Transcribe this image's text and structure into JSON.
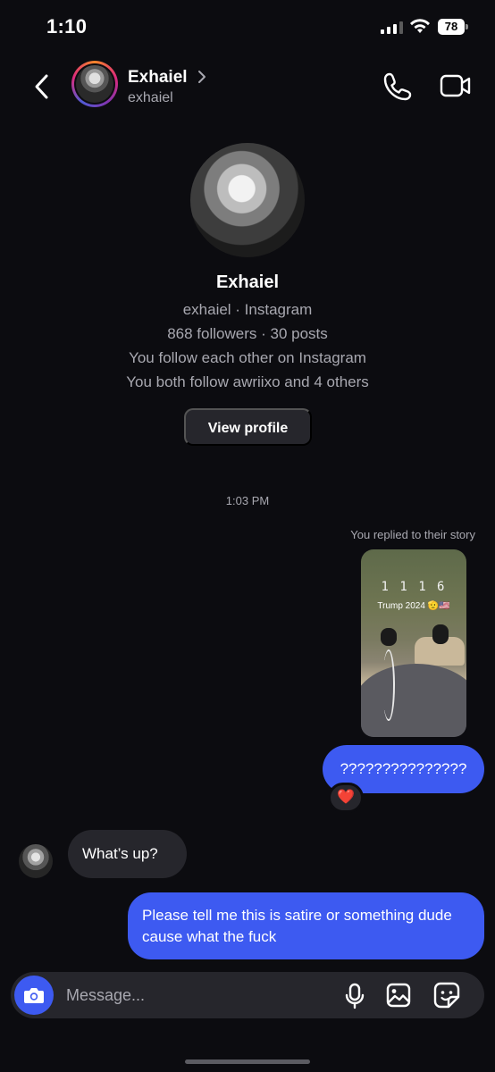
{
  "status_bar": {
    "time": "1:10",
    "battery": "78"
  },
  "header": {
    "name": "Exhaiel",
    "username": "exhaiel"
  },
  "profile": {
    "name": "Exhaiel",
    "subtitle": "exhaiel · Instagram",
    "stats": "868 followers · 30 posts",
    "mutual_follow": "You follow each other on Instagram",
    "mutual_friends": "You both follow awriixo and 4 others",
    "view_profile_label": "View profile"
  },
  "thread": {
    "timestamp": "1:03 PM",
    "story_reply_note": "You replied to their story",
    "story": {
      "clock": "1 1 1 6",
      "caption": "Trump 2024 🫡🇺🇸"
    },
    "messages": [
      {
        "from": "me",
        "text": "???????????????",
        "reaction": "❤️"
      },
      {
        "from": "them",
        "text": "What’s up?"
      },
      {
        "from": "me",
        "text": "Please tell me this is satire or something dude cause what the fuck"
      }
    ]
  },
  "composer": {
    "placeholder": "Message..."
  },
  "colors": {
    "accent": "#3d5af1",
    "background": "#0c0c10",
    "bubble_in": "#26262c"
  }
}
